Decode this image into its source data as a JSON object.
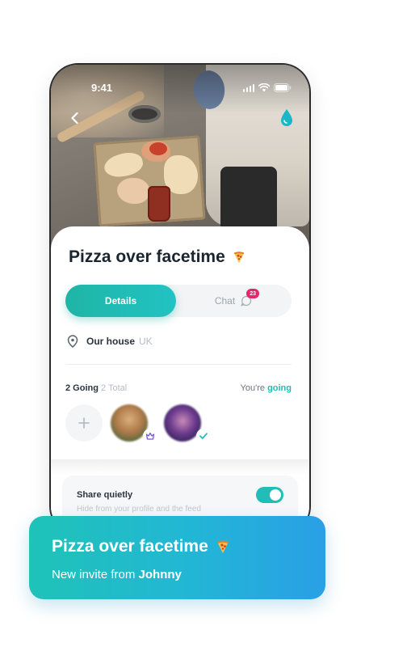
{
  "status_bar": {
    "time": "9:41"
  },
  "event": {
    "title": "Pizza over facetime",
    "title_icon": "pizza-icon"
  },
  "tabs": {
    "details_label": "Details",
    "chat_label": "Chat",
    "chat_unread": "23"
  },
  "location": {
    "name": "Our house",
    "country": "UK"
  },
  "attendance": {
    "going_count": "2 Going",
    "total": "2 Total",
    "rsvp_prefix": "You're",
    "rsvp_status": "going"
  },
  "share": {
    "title": "Share quietly",
    "description": "Hide from your profile and the feed",
    "enabled": true
  },
  "notification": {
    "title": "Pizza over facetime",
    "subtitle_prefix": "New invite from",
    "sender": "Johnny"
  },
  "colors": {
    "accent": "#22bdb8",
    "badge": "#e4266b"
  }
}
